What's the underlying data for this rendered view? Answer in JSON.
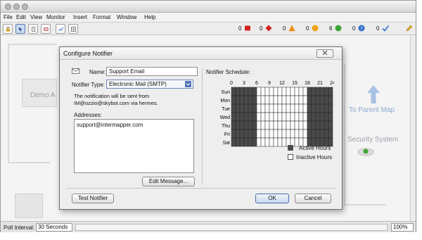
{
  "menu": {
    "items": [
      "File",
      "Edit",
      "View",
      "Monitor",
      "Insert",
      "Format",
      "Window",
      "Help"
    ]
  },
  "toolbar": {
    "status_counts": [
      {
        "count": "0",
        "icon": "red-square-icon",
        "color": "#d42020"
      },
      {
        "count": "0",
        "icon": "red-diamond-icon",
        "color": "#d42020"
      },
      {
        "count": "0",
        "icon": "orange-triangle-icon",
        "color": "#f08a10"
      },
      {
        "count": "0",
        "icon": "yellow-circle-icon",
        "color": "#f2a418"
      },
      {
        "count": "6",
        "icon": "green-circle-icon",
        "color": "#3fa536"
      },
      {
        "count": "0",
        "icon": "blue-question-icon",
        "color": "#2f6fc9"
      },
      {
        "count": "0",
        "icon": "check-icon",
        "color": "#2f6fc9"
      }
    ]
  },
  "map": {
    "left_label": "Demo A",
    "right_top_label": "To Parent Map",
    "right_mid_label": "Security System"
  },
  "status": {
    "poll_label": "Poll Interval:",
    "poll_value": "30 Seconds",
    "zoom_value": "100%"
  },
  "dialog": {
    "title": "Configure Notifier",
    "close_label": "",
    "name_label": "Name:",
    "name_value": "Support Email",
    "type_label": "Notifier Type:",
    "type_value": "Electronic Mail (SMTP)",
    "info_line1": "The notification will be sent from",
    "info_line2": "IM@ozzio@skybot.com via hermes.",
    "addresses_label": "Addresses:",
    "addresses_value": "support@intermapper.com",
    "edit_message_button": "Edit Message...",
    "test_button": "Test Notifier",
    "ok_button": "OK",
    "cancel_button": "Cancel",
    "schedule": {
      "title": "Notifier Schedule:",
      "hours": [
        "0",
        "3",
        "6",
        "9",
        "12",
        "15",
        "18",
        "21",
        "24"
      ],
      "days": [
        "Sun",
        "Mon",
        "Tue",
        "Wed",
        "Thu",
        "Fri",
        "Sat"
      ],
      "active_color": "#4a4a4a",
      "inactive_color": "#ffffff",
      "active_hours_label": "Active Hours",
      "inactive_hours_label": "Inactive Hours"
    }
  }
}
